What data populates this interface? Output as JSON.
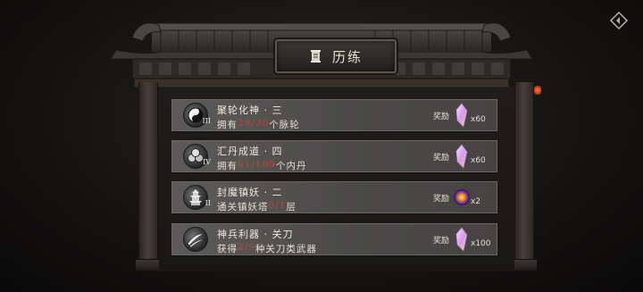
{
  "panel": {
    "title": "历练"
  },
  "quests": [
    {
      "name": "聚轮化神 · 三",
      "prefix": "拥有",
      "current": "29",
      "total": "30",
      "suffix": "个脉轮",
      "tier": "III",
      "icon": "yin-yang-icon",
      "reward_label": "奖励",
      "reward_icon": "crystal-icon",
      "reward_count": "x60"
    },
    {
      "name": "汇丹成道 · 四",
      "prefix": "拥有",
      "current": "61",
      "total": "100",
      "suffix": "个内丹",
      "tier": "IV",
      "icon": "elixir-orbs-icon",
      "reward_label": "奖励",
      "reward_icon": "crystal-icon",
      "reward_count": "x60"
    },
    {
      "name": "封魔镇妖 · 二",
      "prefix": "通关镇妖塔",
      "current": "0",
      "total": "1",
      "suffix": "层",
      "tier": "II",
      "icon": "pagoda-icon",
      "reward_label": "奖励",
      "reward_icon": "orb-icon",
      "reward_count": "x2"
    },
    {
      "name": "神兵利器 · 关刀",
      "prefix": "获得",
      "current": "2",
      "total": "9",
      "suffix": "种关刀类武器",
      "tier": "",
      "icon": "blade-icon",
      "reward_label": "奖励",
      "reward_icon": "crystal-icon",
      "reward_count": "x100"
    }
  ],
  "colors": {
    "progress_red": "#c3443a",
    "row_bg": "#4f4e4d",
    "lantern": "#ff7a2a"
  }
}
